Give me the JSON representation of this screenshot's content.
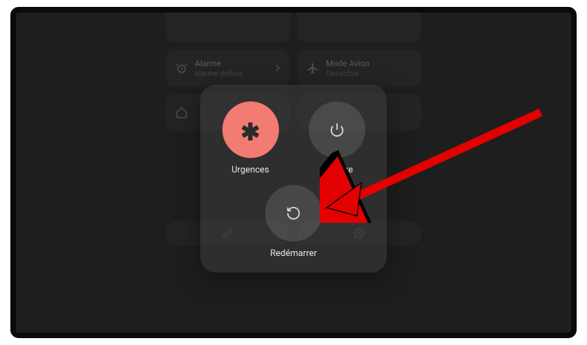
{
  "tiles": {
    "alarm": {
      "title": "Alarme",
      "subtitle": "alarme définie"
    },
    "airplane": {
      "title": "Mode Avion",
      "subtitle": "Désactivé"
    }
  },
  "power": {
    "emergency": "Urgences",
    "shutdown": "Éteindre",
    "restart": "Redémarrer"
  }
}
